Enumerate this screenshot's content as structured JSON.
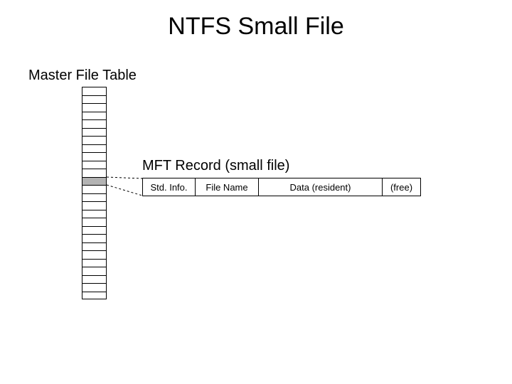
{
  "title": "NTFS Small File",
  "mft": {
    "label": "Master File Table",
    "rows": 26,
    "highlight_index": 11
  },
  "record": {
    "label": "MFT Record (small file)",
    "cells": {
      "std": "Std. Info.",
      "name": "File Name",
      "data": "Data (resident)",
      "free": "(free)"
    }
  }
}
